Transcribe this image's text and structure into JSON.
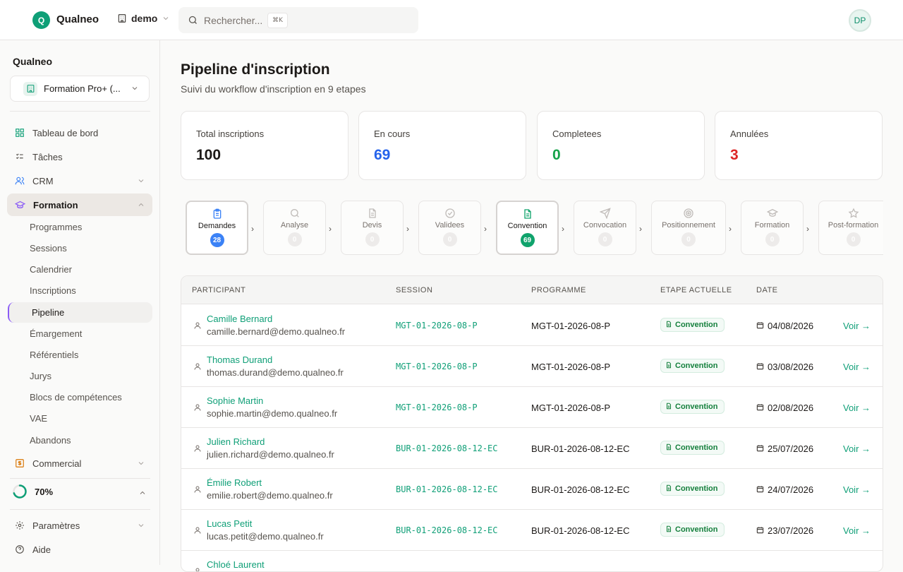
{
  "topbar": {
    "logo_letter": "Q",
    "brand": "Qualneo",
    "org": "demo",
    "search_placeholder": "Rechercher...",
    "search_shortcut": "⌘K",
    "avatar_initials": "DP"
  },
  "sidebar": {
    "title": "Qualneo",
    "workspace": "Formation Pro+ (...",
    "items": [
      {
        "label": "Tableau de bord",
        "icon": "dashboard-icon"
      },
      {
        "label": "Tâches",
        "icon": "tasks-icon"
      },
      {
        "label": "CRM",
        "icon": "users-icon"
      },
      {
        "label": "Formation",
        "icon": "graduation-cap-icon"
      },
      {
        "label": "Commercial",
        "icon": "dollar-icon"
      }
    ],
    "sub_items": [
      "Programmes",
      "Sessions",
      "Calendrier",
      "Inscriptions",
      "Pipeline",
      "Émargement",
      "Référentiels",
      "Jurys",
      "Blocs de compétences",
      "VAE",
      "Abandons"
    ],
    "progress": {
      "label": "70%",
      "value": 0.7
    },
    "footer": [
      {
        "label": "Paramètres",
        "icon": "gear-icon"
      },
      {
        "label": "Aide",
        "icon": "help-icon"
      }
    ]
  },
  "page": {
    "title": "Pipeline d'inscription",
    "subtitle": "Suivi du workflow d'inscription en 9 etapes"
  },
  "stats": [
    {
      "label": "Total inscriptions",
      "value": "100",
      "color": "#1c1917"
    },
    {
      "label": "En cours",
      "value": "69",
      "color": "#2563eb"
    },
    {
      "label": "Completees",
      "value": "0",
      "color": "#16a34a"
    },
    {
      "label": "Annulées",
      "value": "3",
      "color": "#dc2626"
    }
  ],
  "steps": [
    {
      "label": "Demandes",
      "count": "28",
      "badge_color": "#3b82f6",
      "icon": "clipboard-icon",
      "active": true
    },
    {
      "label": "Analyse",
      "count": "0",
      "icon": "search-icon"
    },
    {
      "label": "Devis",
      "count": "0",
      "icon": "file-icon"
    },
    {
      "label": "Validees",
      "count": "0",
      "icon": "check-circle-icon"
    },
    {
      "label": "Convention",
      "count": "69",
      "badge_color": "#10a36c",
      "icon": "file-text-icon",
      "active": true
    },
    {
      "label": "Convocation",
      "count": "0",
      "icon": "send-icon"
    },
    {
      "label": "Positionnement",
      "count": "0",
      "icon": "target-icon"
    },
    {
      "label": "Formation",
      "count": "0",
      "icon": "graduation-cap-icon"
    },
    {
      "label": "Post-formation",
      "count": "0",
      "icon": "star-icon"
    }
  ],
  "table": {
    "headers": [
      "PARTICIPANT",
      "SESSION",
      "PROGRAMME",
      "ETAPE ACTUELLE",
      "DATE"
    ],
    "action_label": "Voir →",
    "rows": [
      {
        "name": "Camille Bernard",
        "email": "camille.bernard@demo.qualneo.fr",
        "session": "MGT-01-2026-08-P",
        "programme": "MGT-01-2026-08-P",
        "stage": "Convention",
        "date": "04/08/2026"
      },
      {
        "name": "Thomas Durand",
        "email": "thomas.durand@demo.qualneo.fr",
        "session": "MGT-01-2026-08-P",
        "programme": "MGT-01-2026-08-P",
        "stage": "Convention",
        "date": "03/08/2026"
      },
      {
        "name": "Sophie Martin",
        "email": "sophie.martin@demo.qualneo.fr",
        "session": "MGT-01-2026-08-P",
        "programme": "MGT-01-2026-08-P",
        "stage": "Convention",
        "date": "02/08/2026"
      },
      {
        "name": "Julien Richard",
        "email": "julien.richard@demo.qualneo.fr",
        "session": "BUR-01-2026-08-12-EC",
        "programme": "BUR-01-2026-08-12-EC",
        "stage": "Convention",
        "date": "25/07/2026"
      },
      {
        "name": "Émilie Robert",
        "email": "emilie.robert@demo.qualneo.fr",
        "session": "BUR-01-2026-08-12-EC",
        "programme": "BUR-01-2026-08-12-EC",
        "stage": "Convention",
        "date": "24/07/2026"
      },
      {
        "name": "Lucas Petit",
        "email": "lucas.petit@demo.qualneo.fr",
        "session": "BUR-01-2026-08-12-EC",
        "programme": "BUR-01-2026-08-12-EC",
        "stage": "Convention",
        "date": "23/07/2026"
      },
      {
        "name": "Chloé Laurent",
        "email": "",
        "session": "",
        "programme": "",
        "stage": "",
        "date": ""
      }
    ]
  }
}
